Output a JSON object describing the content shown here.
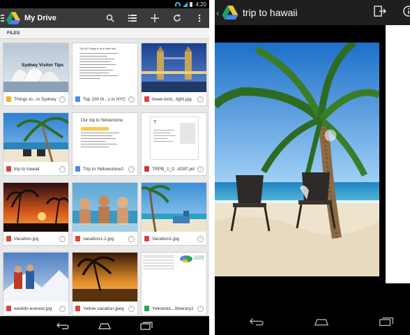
{
  "left": {
    "status": {
      "time": "4:20"
    },
    "app_title": "My Drive",
    "section_label": "FILES",
    "toolbar_icons": [
      "search-icon",
      "list-view-icon",
      "add-icon",
      "refresh-icon",
      "overflow-menu-icon"
    ],
    "files": [
      {
        "name": "Things to...in Sydney",
        "type": "slides",
        "thumb_text": "Sydney Visitor Tips"
      },
      {
        "name": "Top 100 th...s in NYC",
        "type": "doc",
        "thumb_text": "Top 100 Things to do in New York"
      },
      {
        "name": "tower-brid...light.jpg",
        "type": "image"
      },
      {
        "name": "trip to hawaii",
        "type": "image"
      },
      {
        "name": "Trip to Yellowstone2",
        "type": "doc",
        "thumb_text": "Our trip to Yellowstone"
      },
      {
        "name": "TRPB_1_0...8287.pdf",
        "type": "pdf"
      },
      {
        "name": "Vacation.jpg",
        "type": "image"
      },
      {
        "name": "vacation1-1.jpg",
        "type": "image"
      },
      {
        "name": "Vacation1.jpg",
        "type": "image"
      },
      {
        "name": "wedidn-everest.jpg",
        "type": "image"
      },
      {
        "name": "Yellow vacation.jpeg",
        "type": "image"
      },
      {
        "name": "Yellowsto...Itinerary2",
        "type": "sheet"
      }
    ],
    "nav_buttons": [
      "back-icon",
      "home-icon",
      "recents-icon"
    ]
  },
  "right": {
    "title": "trip to hawaii",
    "toolbar_icons": [
      "open-with-icon",
      "info-icon"
    ],
    "nav_buttons": [
      "back-icon",
      "home-icon",
      "recents-icon"
    ]
  },
  "colors": {
    "action_bar": "#3a3a3a",
    "status_bar": "#000000",
    "accent_blue": "#3fb6e8"
  }
}
